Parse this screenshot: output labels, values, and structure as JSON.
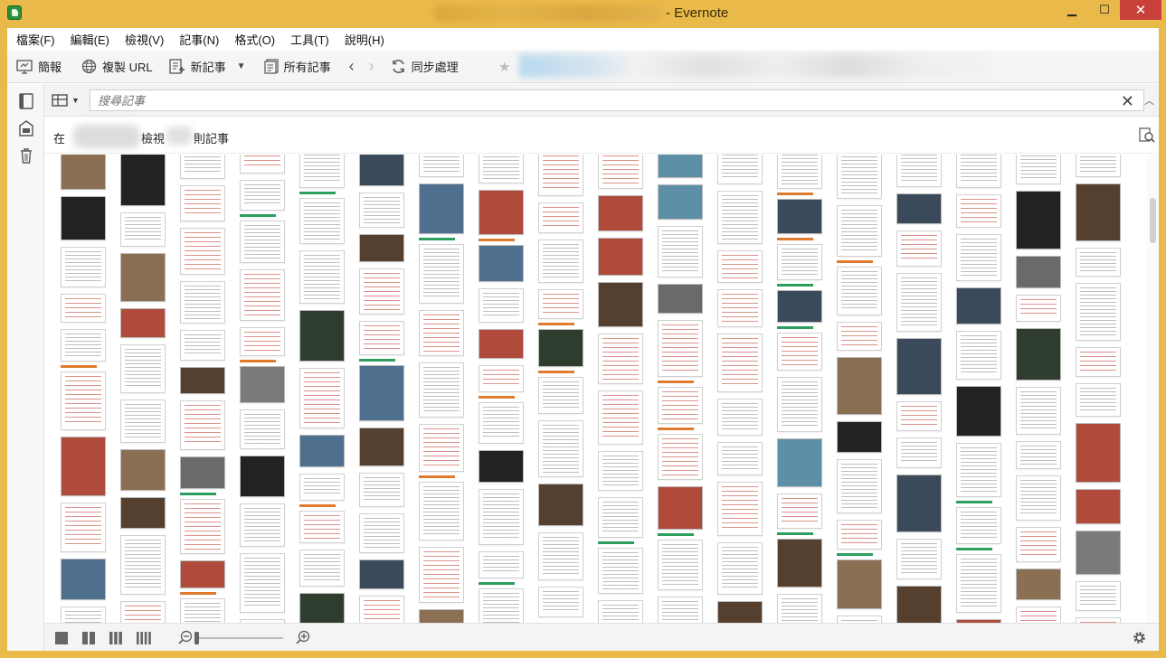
{
  "window": {
    "title": "- Evernote",
    "controls": {
      "minimize": "▁",
      "maximize": "☐",
      "close": "✕"
    }
  },
  "menu": [
    "檔案(F)",
    "編輯(E)",
    "檢視(V)",
    "記事(N)",
    "格式(O)",
    "工具(T)",
    "說明(H)"
  ],
  "toolbar": {
    "clip_label": "簡報",
    "copy_url_label": "複製 URL",
    "new_note_label": "新記事",
    "all_notes_label": "所有記事",
    "sync_label": "同步處理"
  },
  "search": {
    "placeholder": "搜尋記事"
  },
  "context": {
    "prefix": "在",
    "middle": "檢視",
    "suffix": "則記事"
  },
  "colors": {
    "title_bar": "#e9b949",
    "close_button": "#c7403a",
    "orange_tag": "#e07b2e",
    "green_tag": "#2e9e5e"
  },
  "icons": {
    "app": "evernote-icon",
    "clip": "presentation-icon",
    "copy_url": "globe-icon",
    "new_note": "new-note-icon",
    "all_notes": "notes-icon",
    "sync": "sync-icon",
    "back": "chevron-left-icon",
    "forward": "chevron-right-icon",
    "shortcut": "star-icon",
    "settings": "gear-icon"
  }
}
